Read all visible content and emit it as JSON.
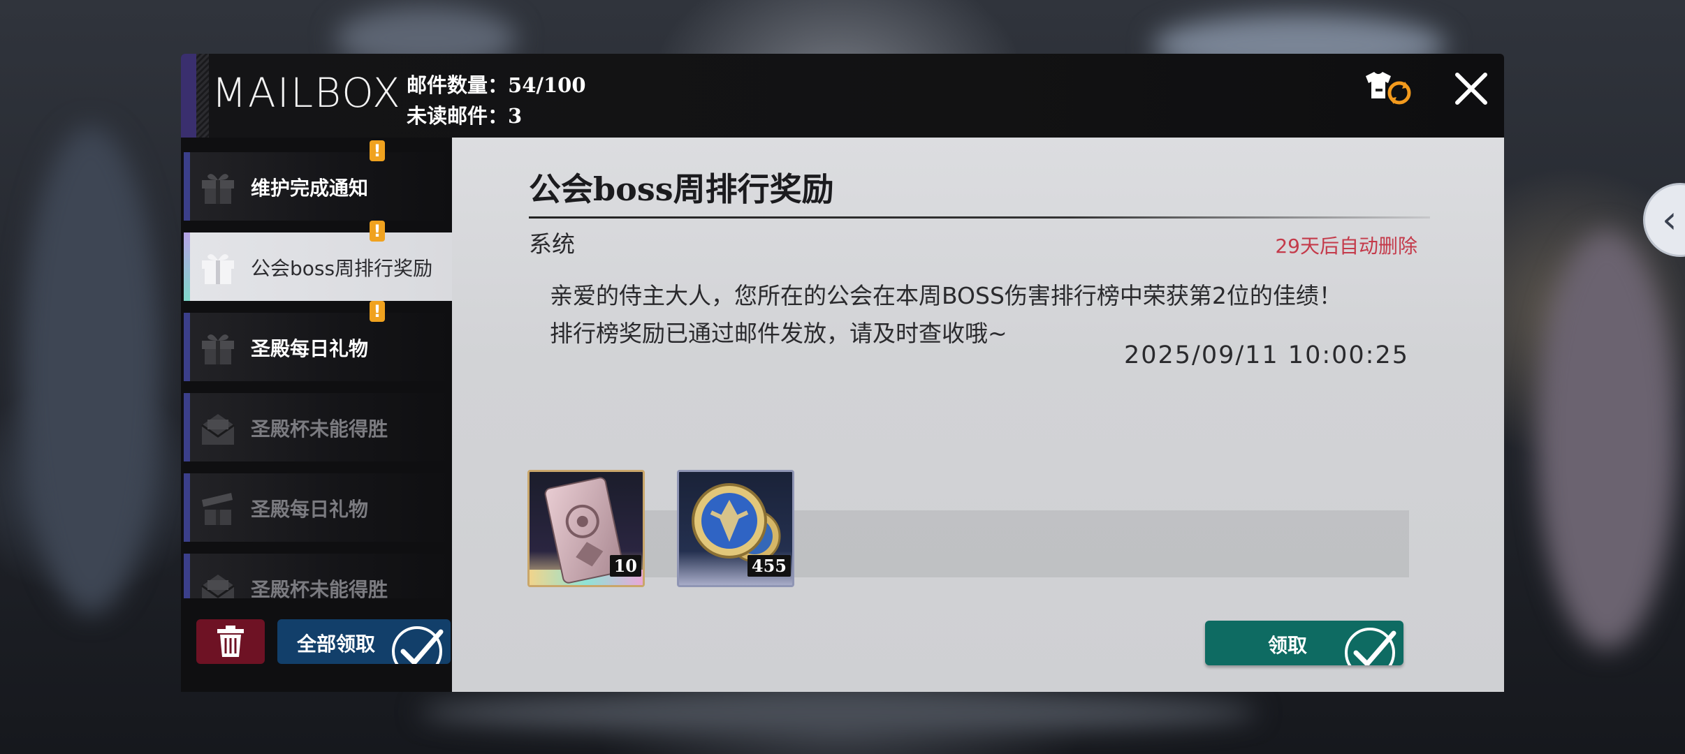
{
  "window": {
    "title": "MAILBOX"
  },
  "header": {
    "mail_count_label": "邮件数量：",
    "mail_count_value": "54/100",
    "unread_label": "未读邮件：",
    "unread_value": "3"
  },
  "mail_list": [
    {
      "label": "维护完成通知",
      "unread": true,
      "active": false,
      "icon": "gift-icon"
    },
    {
      "label": "公会boss周排行奖励",
      "unread": true,
      "active": true,
      "icon": "gift-icon"
    },
    {
      "label": "圣殿每日礼物",
      "unread": true,
      "active": false,
      "icon": "gift-icon"
    },
    {
      "label": "圣殿杯未能得胜",
      "unread": false,
      "active": false,
      "icon": "envelope-open-icon"
    },
    {
      "label": "圣殿每日礼物",
      "unread": false,
      "active": false,
      "icon": "gift-open-icon"
    },
    {
      "label": "圣殿杯未能得胜",
      "unread": false,
      "active": false,
      "icon": "envelope-open-icon"
    }
  ],
  "badge_text": "!",
  "buttons": {
    "claim_all": "全部领取",
    "claim": "领取"
  },
  "mail": {
    "title": "公会boss周排行奖励",
    "sender": "系统",
    "expire_notice": "29天后自动删除",
    "body_line1": "亲爱的侍主大人，您所在的公会在本周BOSS伤害排行榜中荣获第2位的佳绩！",
    "body_line2": "排行榜奖励已通过邮件发放，请及时查收哦~",
    "timestamp": "2025/09/11 10:00:25"
  },
  "rewards": [
    {
      "item": "ticket-icon",
      "quantity": "10"
    },
    {
      "item": "coin-icon",
      "quantity": "455"
    }
  ],
  "colors": {
    "accent_unread_badge": "#f0a21f",
    "expire_red": "#c43a4a",
    "claim_green": "#0e6b62",
    "claim_all_blue": "#123f6a",
    "delete_red": "#6e1224"
  }
}
